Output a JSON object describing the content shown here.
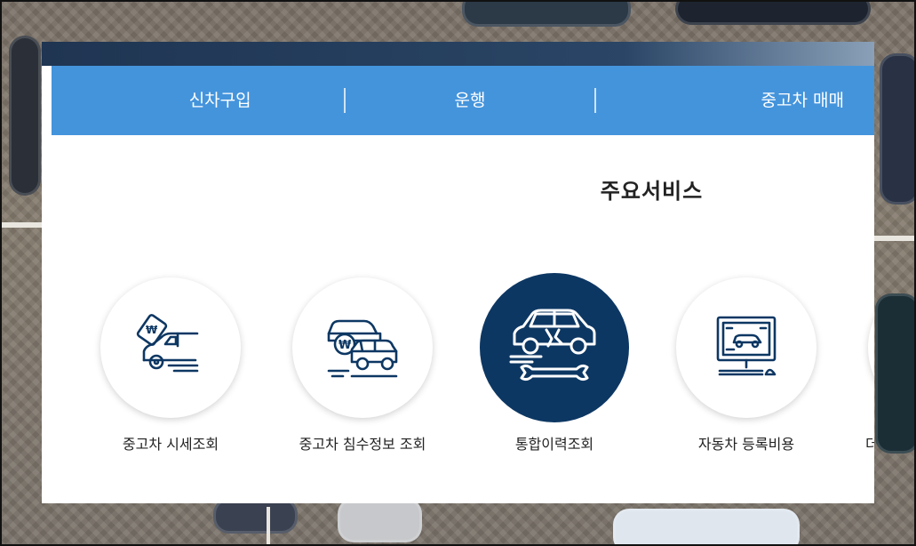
{
  "nav": {
    "items": [
      {
        "label": "신차구입"
      },
      {
        "label": "운행"
      },
      {
        "label": "중고차 매매"
      }
    ]
  },
  "section": {
    "title": "주요서비스"
  },
  "services": [
    {
      "label": "중고차 시세조회",
      "icon": "car-price-tag-icon",
      "active": false
    },
    {
      "label": "중고차 침수정보 조회",
      "icon": "flooded-cars-won-icon",
      "active": false
    },
    {
      "label": "통합이력조회",
      "icon": "car-repair-wrench-icon",
      "active": true
    },
    {
      "label": "자동차 등록비용",
      "icon": "computer-car-registration-icon",
      "active": false
    },
    {
      "label": "더",
      "icon": "next-service-icon",
      "active": false
    }
  ],
  "colors": {
    "nav_bg": "#4494dc",
    "icon_navy": "#0d3763",
    "panel_bg": "#ffffff"
  }
}
